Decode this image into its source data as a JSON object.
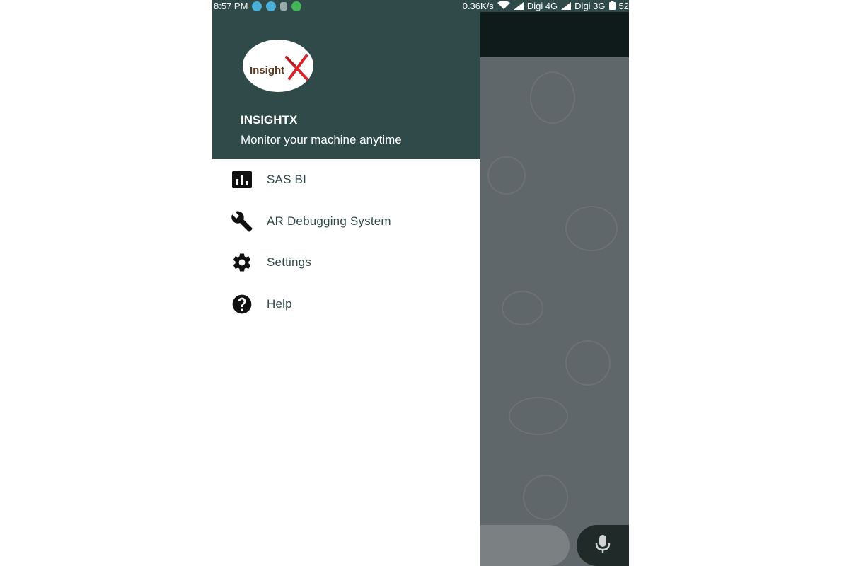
{
  "status_bar": {
    "time": "8:57 PM",
    "speed": "0.36K/s",
    "carrier1": "Digi 4G",
    "carrier2": "Digi 3G",
    "battery": "52"
  },
  "drawer": {
    "logo_text": "InsightX",
    "title": "INSIGHTX",
    "subtitle": "Monitor your machine anytime",
    "items": [
      {
        "label": "SAS BI",
        "icon": "bar-chart-icon"
      },
      {
        "label": "AR Debugging System",
        "icon": "wrench-icon"
      },
      {
        "label": "Settings",
        "icon": "gear-icon"
      },
      {
        "label": "Help",
        "icon": "help-icon"
      }
    ]
  },
  "colors": {
    "header_bg": "#2f4a48",
    "menu_text": "#2f4a48",
    "scrim": "#5c6263"
  }
}
